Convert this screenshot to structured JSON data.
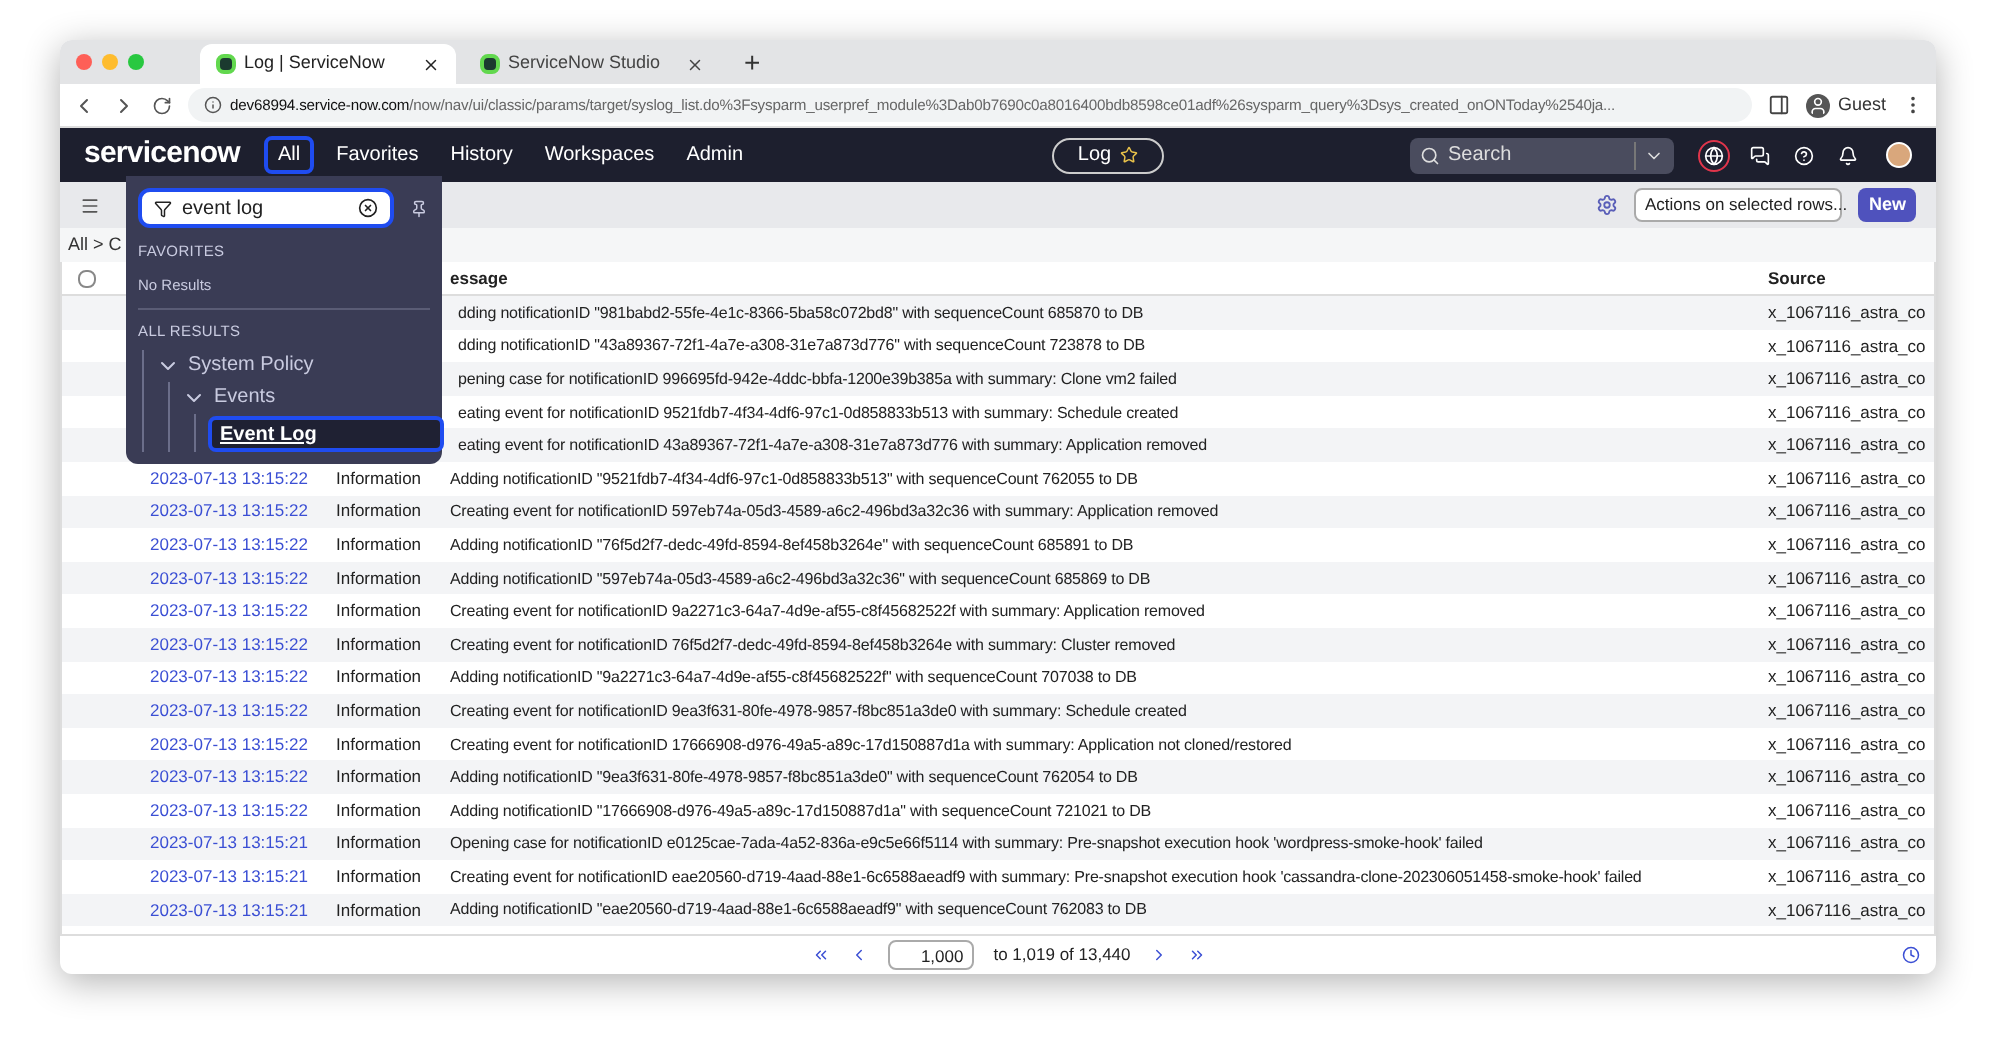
{
  "browser": {
    "tabs": [
      {
        "label": "Log | ServiceNow",
        "selected": true
      },
      {
        "label": "ServiceNow Studio",
        "selected": false
      }
    ],
    "new_tab": "+",
    "url_host": "dev68994.service-now.com",
    "url_path": "/now/nav/ui/classic/params/target/syslog_list.do%3Fsysparm_userpref_module%3Dab0b7690c0a8016400bdb8598ce01adf%26sysparm_query%3Dsys_created_onONToday%2540ja...",
    "profile": "Guest"
  },
  "navbar": {
    "logo": "servicenow",
    "items": [
      {
        "label": "All",
        "selected": true
      },
      {
        "label": "Favorites",
        "selected": false
      },
      {
        "label": "History",
        "selected": false
      },
      {
        "label": "Workspaces",
        "selected": false
      },
      {
        "label": "Admin",
        "selected": false
      }
    ],
    "context": "Log",
    "search_placeholder": "Search"
  },
  "toolbar": {
    "actions_select": "Actions on selected rows...",
    "new_button": "New"
  },
  "breadcrumb": "All > C",
  "table": {
    "select_all_checked": false,
    "columns": [
      "essage",
      "Source"
    ],
    "rows": [
      {
        "timestamp": "",
        "level": "",
        "message": "dding notificationID \"981babd2-55fe-4e1c-8366-5ba58c072bd8\" with sequenceCount 685870 to DB",
        "source": "x_1067116_astra_co"
      },
      {
        "timestamp": "",
        "level": "",
        "message": "dding notificationID \"43a89367-72f1-4a7e-a308-31e7a873d776\" with sequenceCount 723878 to DB",
        "source": "x_1067116_astra_co"
      },
      {
        "timestamp": "",
        "level": "",
        "message": "pening case for notificationID 996695fd-942e-4ddc-bbfa-1200e39b385a with summary: Clone vm2 failed",
        "source": "x_1067116_astra_co"
      },
      {
        "timestamp": "",
        "level": "",
        "message": "eating event for notificationID 9521fdb7-4f34-4df6-97c1-0d858833b513 with summary: Schedule created",
        "source": "x_1067116_astra_co"
      },
      {
        "timestamp": "",
        "level": "",
        "message": "eating event for notificationID 43a89367-72f1-4a7e-a308-31e7a873d776 with summary: Application removed",
        "source": "x_1067116_astra_co"
      },
      {
        "timestamp": "2023-07-13 13:15:22",
        "level": "Information",
        "message": "Adding notificationID \"9521fdb7-4f34-4df6-97c1-0d858833b513\" with sequenceCount 762055 to DB",
        "source": "x_1067116_astra_co"
      },
      {
        "timestamp": "2023-07-13 13:15:22",
        "level": "Information",
        "message": "Creating event for notificationID 597eb74a-05d3-4589-a6c2-496bd3a32c36 with summary: Application removed",
        "source": "x_1067116_astra_co"
      },
      {
        "timestamp": "2023-07-13 13:15:22",
        "level": "Information",
        "message": "Adding notificationID \"76f5d2f7-dedc-49fd-8594-8ef458b3264e\" with sequenceCount 685891 to DB",
        "source": "x_1067116_astra_co"
      },
      {
        "timestamp": "2023-07-13 13:15:22",
        "level": "Information",
        "message": "Adding notificationID \"597eb74a-05d3-4589-a6c2-496bd3a32c36\" with sequenceCount 685869 to DB",
        "source": "x_1067116_astra_co"
      },
      {
        "timestamp": "2023-07-13 13:15:22",
        "level": "Information",
        "message": "Creating event for notificationID 9a2271c3-64a7-4d9e-af55-c8f45682522f with summary: Application removed",
        "source": "x_1067116_astra_co"
      },
      {
        "timestamp": "2023-07-13 13:15:22",
        "level": "Information",
        "message": "Creating event for notificationID 76f5d2f7-dedc-49fd-8594-8ef458b3264e with summary: Cluster removed",
        "source": "x_1067116_astra_co"
      },
      {
        "timestamp": "2023-07-13 13:15:22",
        "level": "Information",
        "message": "Adding notificationID \"9a2271c3-64a7-4d9e-af55-c8f45682522f\" with sequenceCount 707038 to DB",
        "source": "x_1067116_astra_co"
      },
      {
        "timestamp": "2023-07-13 13:15:22",
        "level": "Information",
        "message": "Creating event for notificationID 9ea3f631-80fe-4978-9857-f8bc851a3de0 with summary: Schedule created",
        "source": "x_1067116_astra_co"
      },
      {
        "timestamp": "2023-07-13 13:15:22",
        "level": "Information",
        "message": "Creating event for notificationID 17666908-d976-49a5-a89c-17d150887d1a with summary: Application not cloned/restored",
        "source": "x_1067116_astra_co"
      },
      {
        "timestamp": "2023-07-13 13:15:22",
        "level": "Information",
        "message": "Adding notificationID \"9ea3f631-80fe-4978-9857-f8bc851a3de0\" with sequenceCount 762054 to DB",
        "source": "x_1067116_astra_co"
      },
      {
        "timestamp": "2023-07-13 13:15:22",
        "level": "Information",
        "message": "Adding notificationID \"17666908-d976-49a5-a89c-17d150887d1a\" with sequenceCount 721021 to DB",
        "source": "x_1067116_astra_co"
      },
      {
        "timestamp": "2023-07-13 13:15:21",
        "level": "Information",
        "message": "Opening case for notificationID e0125cae-7ada-4a52-836a-e9c5e66f5114 with summary: Pre-snapshot execution hook 'wordpress-smoke-hook' failed",
        "source": "x_1067116_astra_co"
      },
      {
        "timestamp": "2023-07-13 13:15:21",
        "level": "Information",
        "message": "Creating event for notificationID eae20560-d719-4aad-88e1-6c6588aeadf9 with summary: Pre-snapshot execution hook 'cassandra-clone-202306051458-smoke-hook' failed",
        "source": "x_1067116_astra_co"
      },
      {
        "timestamp": "2023-07-13 13:15:21",
        "level": "Information",
        "message": "Adding notificationID \"eae20560-d719-4aad-88e1-6c6588aeadf9\" with sequenceCount 762083 to DB",
        "source": "x_1067116_astra_co"
      }
    ]
  },
  "pagination": {
    "first_row": "1,000",
    "range": "to 1,019 of 13,440"
  },
  "menu": {
    "filter_value": "event log",
    "favorites_heading": "FAVORITES",
    "favorites_empty": "No Results",
    "results_heading": "ALL RESULTS",
    "tree": [
      {
        "label": "System Policy",
        "expanded": true,
        "children": [
          {
            "label": "Events",
            "expanded": true,
            "children": [
              {
                "label": "Event Log",
                "selected": true
              }
            ]
          }
        ]
      }
    ]
  }
}
